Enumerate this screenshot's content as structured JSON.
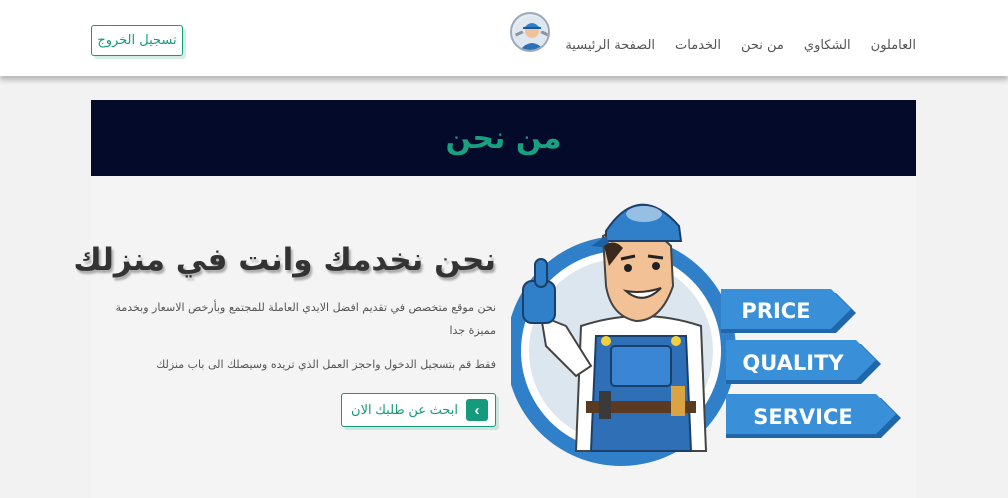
{
  "nav": {
    "links": [
      "الصفحة الرئيسية",
      "الخدمات",
      "من نحن",
      "الشكاوي",
      "العاملون"
    ],
    "logout_label": "تسجيل الخروج"
  },
  "hero": {
    "title": "من نحن"
  },
  "about": {
    "headline": "نحن نخدمك وانت في منزلك",
    "paragraph1": "نحن موقع متخصص في تقديم افضل الايدي العاملة للمجتمع وبأرخص الاسعار وبخدمة مميزة جدا",
    "paragraph2": "فقط قم بتسجيل الدخول واحجز العمل الذي تريده وسيصلك الى باب منزلك",
    "cta_label": "ابحث عن طلبك الان"
  },
  "illustration": {
    "ribbons": [
      "PRICE",
      "QUALITY",
      "SERVICE"
    ]
  },
  "colors": {
    "accent": "#159a7c",
    "hero_bg": "#030a2a",
    "badge_blue": "#2f7fc9"
  },
  "icons": {
    "logo": "worker-logo-icon",
    "cta": "chevron-left-icon"
  }
}
